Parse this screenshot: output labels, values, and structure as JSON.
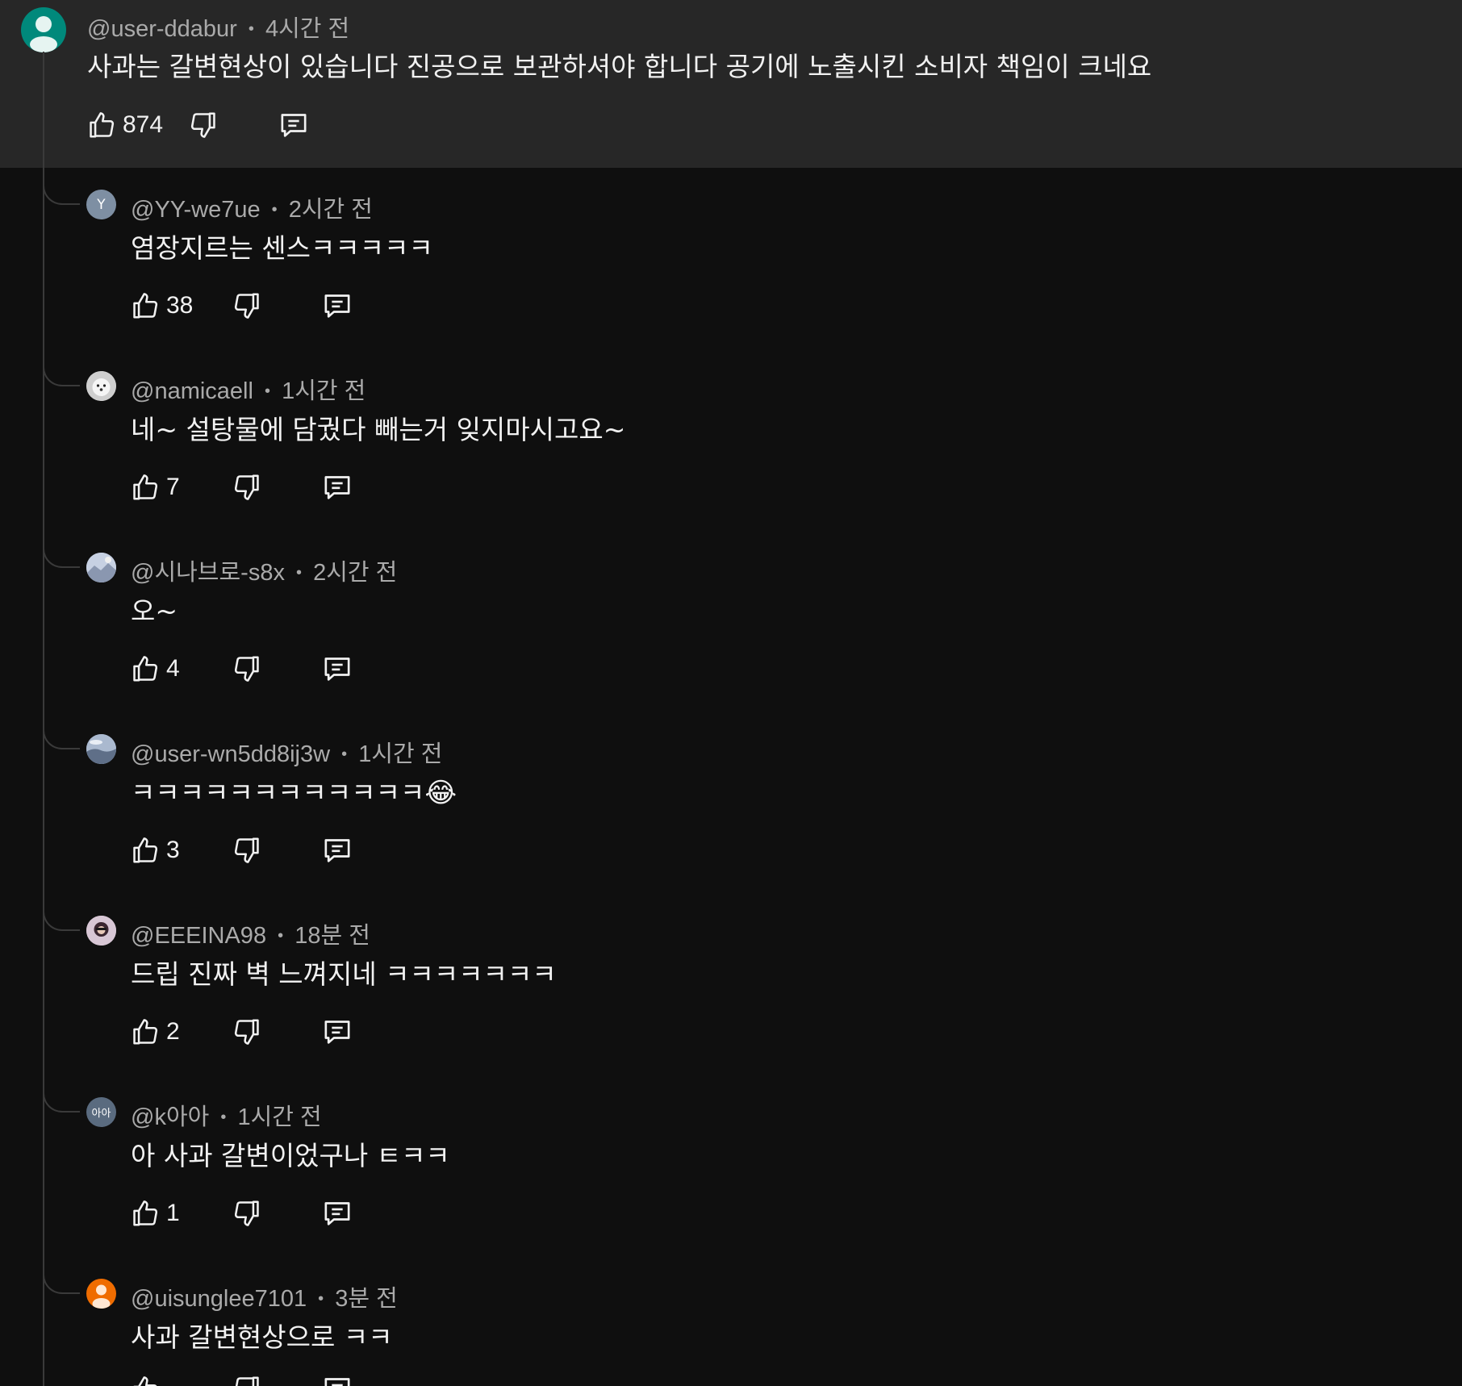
{
  "top_comment": {
    "author": "@user-ddabur",
    "time": "4시간 전",
    "text": "사과는 갈변현상이 있습니다 진공으로 보관하셔야 합니다 공기에 노출시킨 소비자 책임이 크네요",
    "likes": "874",
    "avatar_color": "#00897b"
  },
  "replies": [
    {
      "author": "@YY-we7ue",
      "time": "2시간 전",
      "text": "염장지르는 센스ㅋㅋㅋㅋㅋ",
      "likes": "38",
      "avatar_letter": "Y",
      "avatar_color": "#7e8fa3"
    },
    {
      "author": "@namicaell",
      "time": "1시간 전",
      "text": "네~ 설탕물에 담궜다 빼는거 잊지마시고요~",
      "likes": "7",
      "avatar_color": "#d9d9d9"
    },
    {
      "author": "@시나브로-s8x",
      "time": "2시간 전",
      "text": "오~",
      "likes": "4",
      "avatar_color": "#b9c3d6"
    },
    {
      "author": "@user-wn5dd8ij3w",
      "time": "1시간 전",
      "text": "ㅋㅋㅋㅋㅋㅋㅋㅋㅋㅋㅋㅋ",
      "emoji": "😂",
      "likes": "3",
      "avatar_color": "#8ea2bf"
    },
    {
      "author": "@EEEINA98",
      "time": "18분 전",
      "text": "드립 진짜 벽 느껴지네 ㅋㅋㅋㅋㅋㅋㅋ",
      "likes": "2",
      "avatar_color": "#c9b8c8"
    },
    {
      "author": "@k아아",
      "time": "1시간 전",
      "text": "아 사과 갈변이었구나 ㅌㅋㅋ",
      "likes": "1",
      "avatar_letter": "아아",
      "avatar_color": "#5a6b7f"
    },
    {
      "author": "@uisunglee7101",
      "time": "3분 전",
      "text": "사과 갈변현상으로 ㅋㅋ",
      "likes": "",
      "avatar_color": "#ef6c00"
    }
  ],
  "icons": {
    "like": "thumbs-up-icon",
    "dislike": "thumbs-down-icon",
    "reply": "comment-icon",
    "separator": "•"
  },
  "colors": {
    "background": "#0f0f0f",
    "highlight": "#272727",
    "text_primary": "#f1f1f1",
    "text_secondary": "#aaaaaa"
  }
}
